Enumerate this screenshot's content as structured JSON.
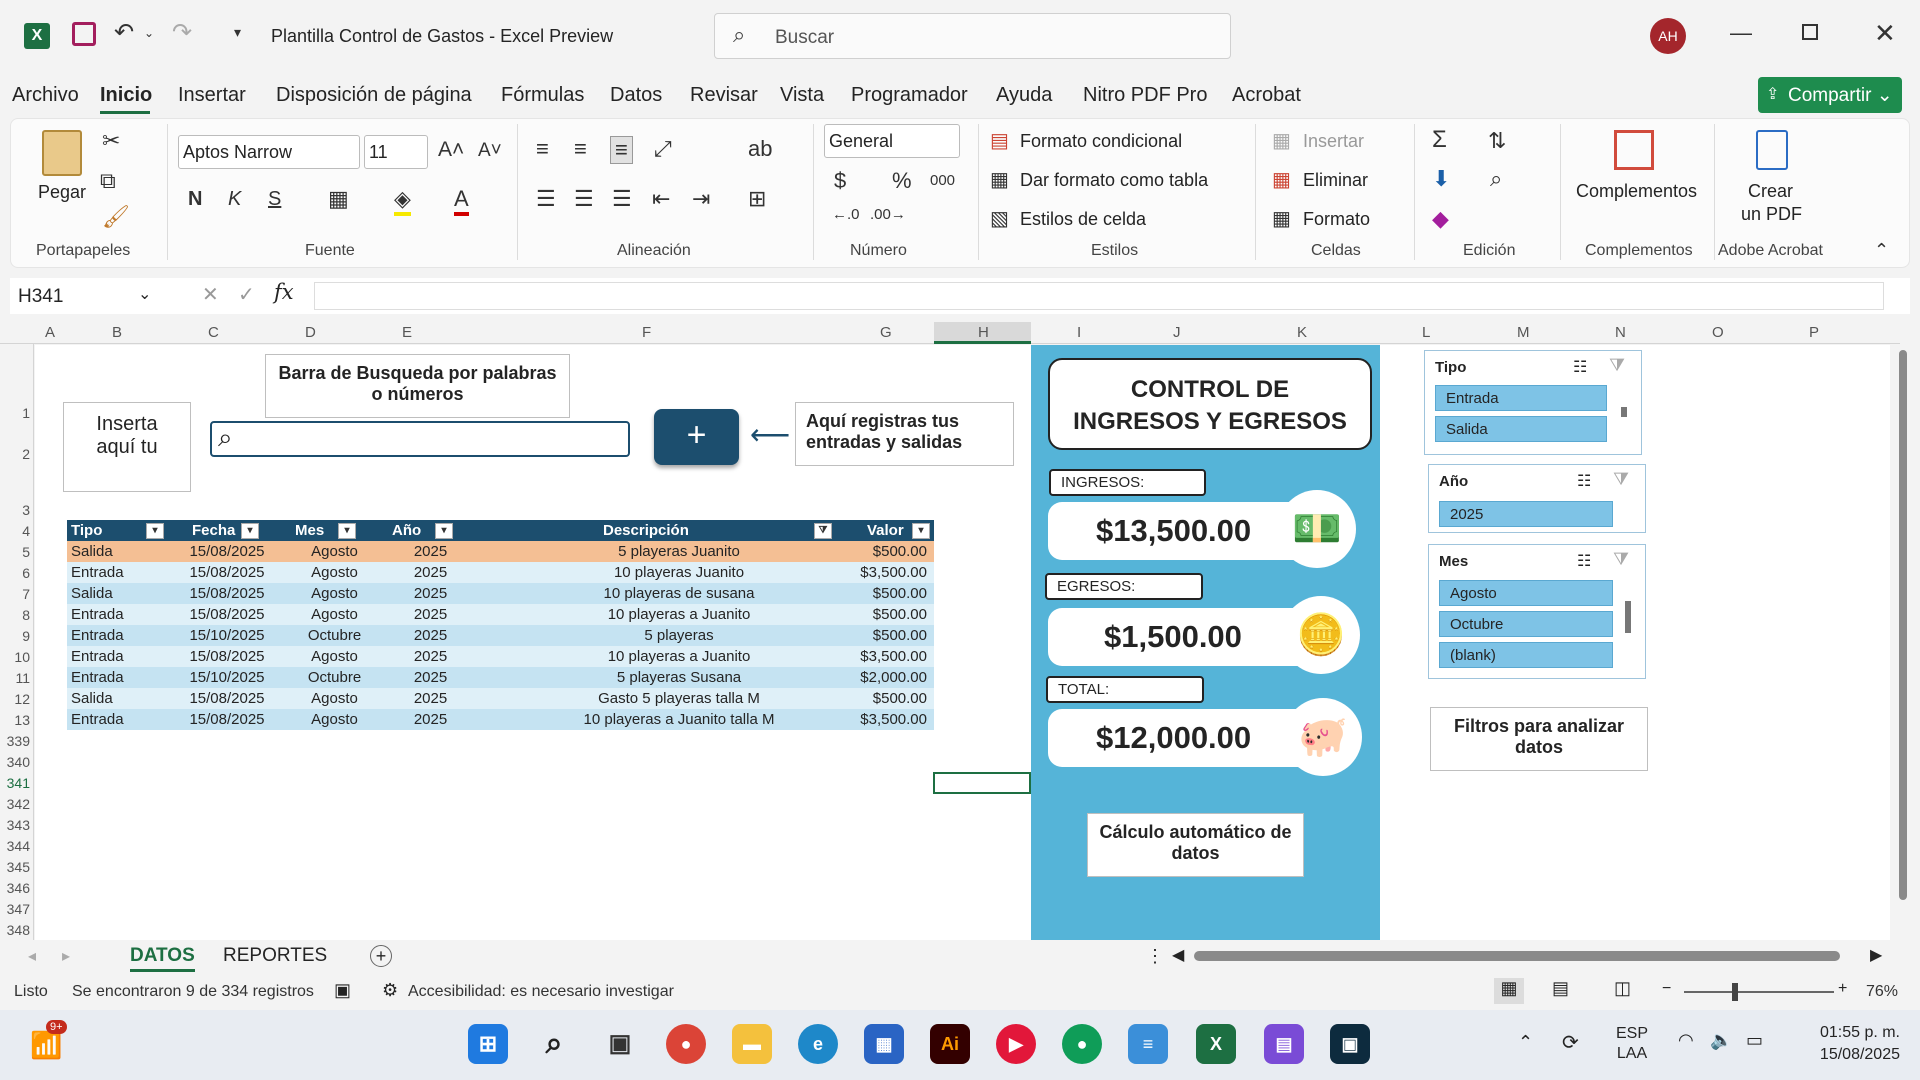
{
  "titlebar": {
    "title": "Plantilla Control de Gastos  -  Excel Preview",
    "search_placeholder": "Buscar",
    "avatar": "AH"
  },
  "menu": [
    "Archivo",
    "Inicio",
    "Insertar",
    "Disposición de página",
    "Fórmulas",
    "Datos",
    "Revisar",
    "Vista",
    "Programador",
    "Ayuda",
    "Nitro PDF Pro",
    "Acrobat"
  ],
  "share": "Compartir",
  "ribbon": {
    "paste": "Pegar",
    "font_name": "Aptos Narrow",
    "font_size": "11",
    "number_format": "General",
    "cond_format": "Formato condicional",
    "table_format": "Dar formato como tabla",
    "cell_styles": "Estilos de celda",
    "insert": "Insertar",
    "delete": "Eliminar",
    "format": "Formato",
    "addins": "Complementos",
    "create_pdf_1": "Crear",
    "create_pdf_2": "un PDF",
    "groups": [
      "Portapapeles",
      "Fuente",
      "Alineación",
      "Número",
      "Estilos",
      "Celdas",
      "Edición",
      "Complementos",
      "Adobe Acrobat"
    ],
    "bold": "N",
    "italic": "K",
    "underline": "S"
  },
  "namebox": "H341",
  "columns": [
    "A",
    "B",
    "C",
    "D",
    "E",
    "F",
    "G",
    "H",
    "I",
    "J",
    "K",
    "L",
    "M",
    "N",
    "O",
    "P"
  ],
  "rows": [
    "1",
    "2",
    "3",
    "4",
    "5",
    "6",
    "7",
    "8",
    "9",
    "10",
    "11",
    "12",
    "13",
    "339",
    "340",
    "341",
    "342",
    "343",
    "344",
    "345",
    "346",
    "347",
    "348"
  ],
  "labels": {
    "insert_here": "Inserta aquí tu",
    "search_bar": "Barra de Busqueda por palabras o números",
    "register": "Aquí registras tus entradas y salidas",
    "plus": "+",
    "filters": "Filtros para analizar datos",
    "auto_calc": "Cálculo automático de datos"
  },
  "table": {
    "headers": [
      "Tipo",
      "Fecha",
      "Mes",
      "Año",
      "Descripción",
      "Valor"
    ],
    "rows": [
      [
        "Salida",
        "15/08/2025",
        "Agosto",
        "2025",
        "5 playeras Juanito",
        "$500.00"
      ],
      [
        "Entrada",
        "15/08/2025",
        "Agosto",
        "2025",
        "10 playeras Juanito",
        "$3,500.00"
      ],
      [
        "Salida",
        "15/08/2025",
        "Agosto",
        "2025",
        "10 playeras de susana",
        "$500.00"
      ],
      [
        "Entrada",
        "15/08/2025",
        "Agosto",
        "2025",
        "10 playeras a Juanito",
        "$500.00"
      ],
      [
        "Entrada",
        "15/10/2025",
        "Octubre",
        "2025",
        "5 playeras",
        "$500.00"
      ],
      [
        "Entrada",
        "15/08/2025",
        "Agosto",
        "2025",
        "10 playeras a Juanito",
        "$3,500.00"
      ],
      [
        "Entrada",
        "15/10/2025",
        "Octubre",
        "2025",
        "5 playeras Susana",
        "$2,000.00"
      ],
      [
        "Salida",
        "15/08/2025",
        "Agosto",
        "2025",
        "Gasto 5 playeras talla M",
        "$500.00"
      ],
      [
        "Entrada",
        "15/08/2025",
        "Agosto",
        "2025",
        "10 playeras a Juanito talla M",
        "$3,500.00"
      ]
    ]
  },
  "dashboard": {
    "title": "CONTROL DE INGRESOS Y EGRESOS",
    "income_label": "INGRESOS:",
    "income": "$13,500.00",
    "expense_label": "EGRESOS:",
    "expense": "$1,500.00",
    "total_label": "TOTAL:",
    "total": "$12,000.00"
  },
  "slicers": {
    "tipo": {
      "title": "Tipo",
      "items": [
        "Entrada",
        "Salida"
      ]
    },
    "anio": {
      "title": "Año",
      "items": [
        "2025"
      ]
    },
    "mes": {
      "title": "Mes",
      "items": [
        "Agosto",
        "Octubre",
        "(blank)"
      ]
    }
  },
  "tabs": [
    "DATOS",
    "REPORTES"
  ],
  "status": {
    "ready": "Listo",
    "found": "Se encontraron 9 de 334 registros",
    "accessibility": "Accesibilidad: es necesario investigar",
    "zoom": "76%"
  },
  "taskbar": {
    "lang1": "ESP",
    "lang2": "LAA",
    "time": "01:55 p. m.",
    "date": "15/08/2025",
    "badge": "9+"
  },
  "colors": {
    "accent": "#1d6f42",
    "table_header": "#1c4e6e",
    "row_blue": "#c5e3f2",
    "row_selected": "#f4bf94",
    "panel": "#55b4d8"
  }
}
